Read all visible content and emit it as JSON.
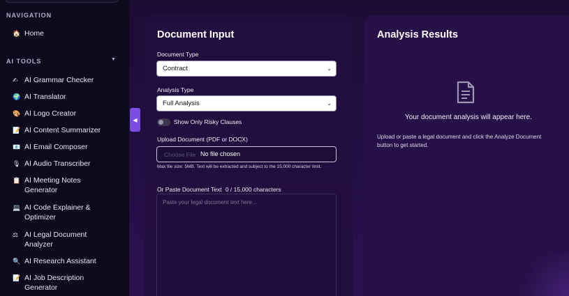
{
  "sidebar": {
    "navigation_label": "NAVIGATION",
    "home": {
      "icon": "home-icon",
      "glyph": "🏠",
      "label": "Home"
    },
    "ai_tools_label": "AI TOOLS",
    "ai_tools_caret": "▼",
    "items": [
      {
        "icon": "writing-hand-icon",
        "glyph": "✍",
        "label": "AI Grammar Checker"
      },
      {
        "icon": "globe-icon",
        "glyph": "🌍",
        "label": "AI Translator"
      },
      {
        "icon": "palette-icon",
        "glyph": "🎨",
        "label": "AI Logo Creator"
      },
      {
        "icon": "memo-icon",
        "glyph": "📝",
        "label": "AI Content Summarizer"
      },
      {
        "icon": "email-icon",
        "glyph": "📧",
        "label": "AI Email Composer"
      },
      {
        "icon": "microphone-icon",
        "glyph": "🎙",
        "label": "AI Audio Transcriber"
      },
      {
        "icon": "clipboard-icon",
        "glyph": "📋",
        "label": "AI Meeting Notes Generator"
      },
      {
        "icon": "laptop-icon",
        "glyph": "💻",
        "label": "AI Code Explainer & Optimizer"
      },
      {
        "icon": "scales-icon",
        "glyph": "⚖",
        "label": "AI Legal Document Analyzer"
      },
      {
        "icon": "magnifier-icon",
        "glyph": "🔍",
        "label": "AI Research Assistant"
      },
      {
        "icon": "memo-icon",
        "glyph": "📝",
        "label": "AI Job Description Generator"
      }
    ]
  },
  "collapse_button": {
    "glyph": "◀"
  },
  "document_input": {
    "title": "Document Input",
    "document_type_label": "Document Type",
    "document_type_value": "Contract",
    "analysis_type_label": "Analysis Type",
    "analysis_type_value": "Full Analysis",
    "risky_toggle_label": "Show Only Risky Clauses",
    "upload_label": "Upload Document (PDF or DOCX)",
    "file_button_label": "Choose File",
    "file_status": "No file chosen",
    "upload_help": "Max file size: 5MB. Text will be extracted and subject to the 15,000 character limit.",
    "paste_label": "Or Paste Document Text",
    "char_count": "0 / 15,000 characters",
    "paste_placeholder": "Paste your legal document text here..."
  },
  "analysis_results": {
    "title": "Analysis Results",
    "empty_message": "Your document analysis will appear here.",
    "empty_subtext": "Upload or paste a legal document and click the Analyze Document button to get started.",
    "empty_icon": "document-icon"
  },
  "colors": {
    "accent": "#7b4de0",
    "sidebar_bg": "#0d0a1e",
    "panel_bg": "#220e3e"
  }
}
